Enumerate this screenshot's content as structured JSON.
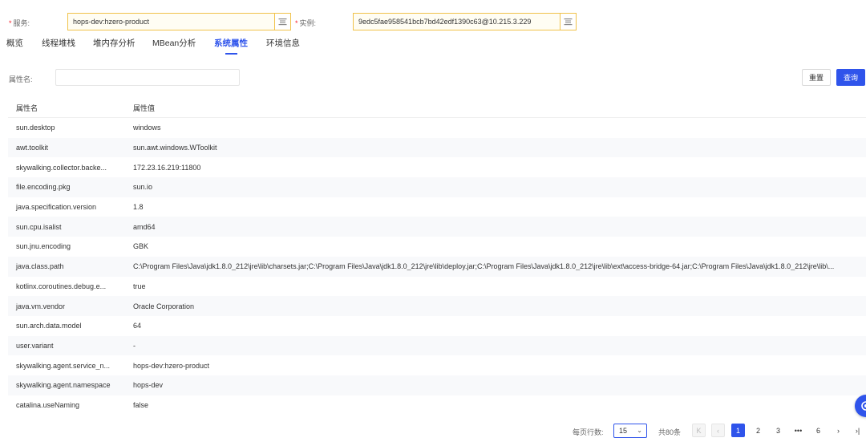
{
  "filters": {
    "service_label": "服务:",
    "service_value": "hops-dev:hzero-product",
    "instance_label": "实例:",
    "instance_value": "9edc5fae958541bcb7bd42edf1390c63@10.215.3.229"
  },
  "tabs": [
    {
      "label": "概览",
      "active": false
    },
    {
      "label": "线程堆栈",
      "active": false
    },
    {
      "label": "堆内存分析",
      "active": false
    },
    {
      "label": "MBean分析",
      "active": false
    },
    {
      "label": "系统属性",
      "active": true
    },
    {
      "label": "环境信息",
      "active": false
    }
  ],
  "search": {
    "label": "属性名:",
    "value": "",
    "reset_label": "重置",
    "query_label": "查询"
  },
  "table": {
    "headers": [
      "属性名",
      "属性值"
    ],
    "rows": [
      {
        "name": "sun.desktop",
        "value": "windows"
      },
      {
        "name": "awt.toolkit",
        "value": "sun.awt.windows.WToolkit"
      },
      {
        "name": "skywalking.collector.backe...",
        "value": "172.23.16.219:11800"
      },
      {
        "name": "file.encoding.pkg",
        "value": "sun.io"
      },
      {
        "name": "java.specification.version",
        "value": "1.8"
      },
      {
        "name": "sun.cpu.isalist",
        "value": "amd64"
      },
      {
        "name": "sun.jnu.encoding",
        "value": "GBK"
      },
      {
        "name": "java.class.path",
        "value": "C:\\Program Files\\Java\\jdk1.8.0_212\\jre\\lib\\charsets.jar;C:\\Program Files\\Java\\jdk1.8.0_212\\jre\\lib\\deploy.jar;C:\\Program Files\\Java\\jdk1.8.0_212\\jre\\lib\\ext\\access-bridge-64.jar;C:\\Program Files\\Java\\jdk1.8.0_212\\jre\\lib\\..."
      },
      {
        "name": "kotlinx.coroutines.debug.e...",
        "value": "true"
      },
      {
        "name": "java.vm.vendor",
        "value": "Oracle Corporation"
      },
      {
        "name": "sun.arch.data.model",
        "value": "64"
      },
      {
        "name": "user.variant",
        "value": "-"
      },
      {
        "name": "skywalking.agent.service_n...",
        "value": "hops-dev:hzero-product"
      },
      {
        "name": "skywalking.agent.namespace",
        "value": "hops-dev"
      },
      {
        "name": "catalina.useNaming",
        "value": "false"
      }
    ]
  },
  "pagination": {
    "page_size_label": "每页行数:",
    "page_size": "15",
    "total_label": "共80条",
    "pages": [
      "1",
      "2",
      "3",
      "•••",
      "6"
    ],
    "current": "1",
    "first_icon": "first-page-icon",
    "prev_icon": "prev-page-icon",
    "next_icon": "next-page-icon",
    "last_icon": "last-page-icon"
  },
  "colors": {
    "primary": "#2f54eb",
    "lookup_border": "#f0c24a",
    "required": "#f5222d"
  }
}
